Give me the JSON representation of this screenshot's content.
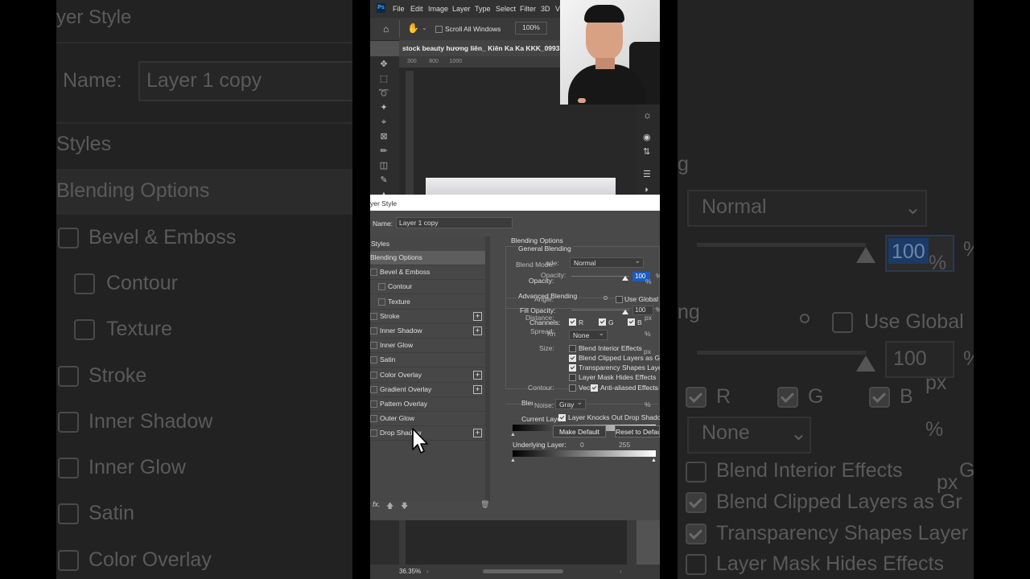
{
  "bg_left": {
    "title": "yer Style",
    "name_label": "Name:",
    "name_value": "Layer 1 copy",
    "styles": "Styles",
    "items": [
      "Blending Options",
      "Bevel & Emboss",
      "Contour",
      "Texture",
      "Stroke",
      "Inner Shadow",
      "Inner Glow",
      "Satin",
      "Color Overlay"
    ]
  },
  "bg_right": {
    "partial_g": "g",
    "blend_mode": "Normal",
    "opacity_value": "100",
    "percent": "%",
    "ng": "ng",
    "use_global": "Use Global",
    "fill_value": "100",
    "px": "px",
    "channel_r": "R",
    "channel_g": "G",
    "channel_b": "B",
    "knockout": "None",
    "blend_interior": "Blend Interior Effects",
    "blend_clipped": "Blend Clipped Layers as Gr",
    "transparency": "Transparency Shapes Layer",
    "layer_mask": "Layer Mask Hides Effects",
    "px2": "px",
    "gr": "Gr"
  },
  "menu": [
    "File",
    "Edit",
    "Image",
    "Layer",
    "Type",
    "Select",
    "Filter",
    "3D",
    "V"
  ],
  "options_bar": {
    "scroll_all": "Scroll All Windows",
    "zoom": "100%"
  },
  "doc": {
    "tab_title": "stock beauty hương liên_ Kiên Ka Ka KKK_0993",
    "ruler": "300        800       1000"
  },
  "status": {
    "zoom": "36.35%"
  },
  "dialog": {
    "title": "yer Style",
    "name_label": "Name:",
    "name_value": "Layer 1 copy",
    "styles_header": "Styles",
    "styles": [
      {
        "label": "Blending Options",
        "selected": true,
        "checkbox": false,
        "plus": false,
        "indent": 0
      },
      {
        "label": "Bevel & Emboss",
        "selected": false,
        "checkbox": true,
        "plus": false,
        "indent": 1
      },
      {
        "label": "Contour",
        "selected": false,
        "checkbox": true,
        "plus": false,
        "indent": 2
      },
      {
        "label": "Texture",
        "selected": false,
        "checkbox": true,
        "plus": false,
        "indent": 2
      },
      {
        "label": "Stroke",
        "selected": false,
        "checkbox": true,
        "plus": true,
        "indent": 1
      },
      {
        "label": "Inner Shadow",
        "selected": false,
        "checkbox": true,
        "plus": true,
        "indent": 1
      },
      {
        "label": "Inner Glow",
        "selected": false,
        "checkbox": true,
        "plus": false,
        "indent": 1
      },
      {
        "label": "Satin",
        "selected": false,
        "checkbox": true,
        "plus": false,
        "indent": 1
      },
      {
        "label": "Color Overlay",
        "selected": false,
        "checkbox": true,
        "plus": true,
        "indent": 1
      },
      {
        "label": "Gradient Overlay",
        "selected": false,
        "checkbox": true,
        "plus": true,
        "indent": 1
      },
      {
        "label": "Pattern Overlay",
        "selected": false,
        "checkbox": true,
        "plus": false,
        "indent": 1
      },
      {
        "label": "Outer Glow",
        "selected": false,
        "checkbox": true,
        "plus": false,
        "indent": 1
      },
      {
        "label": "Drop Shadow",
        "selected": false,
        "checkbox": true,
        "plus": true,
        "indent": 1
      }
    ],
    "blending_options": "Blending Options",
    "general_blending": "General Blending",
    "blend_mode_label": "Blend Mode:",
    "blend_mode_ghost": "ode:",
    "blend_mode_value": "Normal",
    "opacity_label": "Opacity:",
    "opacity_ghost": "Opacity:",
    "opacity_value": "100",
    "percent": "%",
    "advanced_blending": "Advanced Blending",
    "angle_label": "Angle:",
    "use_global": "Use Global",
    "fill_opacity_label": "Fill Opacity:",
    "fill_value": "100",
    "distance_label": "Distance:",
    "channels_label": "Channels:",
    "channel_r": "R",
    "channel_g": "G",
    "channel_b": "B",
    "px": "px",
    "spread_label": "Spread:",
    "knockout_label": "Knockout:",
    "knockout_value": "None",
    "size_label": "Size:",
    "blend_interior": "Blend Interior Effects",
    "blend_clipped": "Blend Clipped Layers as Gr",
    "transparency": "Transparency Shapes Layer",
    "layer_mask": "Layer Mask Hides Effects",
    "vector_mask": "Vector Mask Hides Effects",
    "contour_label": "Contour:",
    "anti_aliased": "Anti-aliased",
    "blend_if": "Blend If:",
    "noise_label": "Noise:",
    "noise_value": "Gray",
    "current_layer": "Current Layer:",
    "cl_min": "0",
    "cl_max": "255",
    "layer_knocks": "Layer Knocks Out Drop Shadow",
    "make_default": "Make Default",
    "reset_default": "Reset to Default",
    "underlying_layer": "Underlying Layer:",
    "ul_min": "0",
    "ul_max": "255",
    "fx": "fx."
  }
}
